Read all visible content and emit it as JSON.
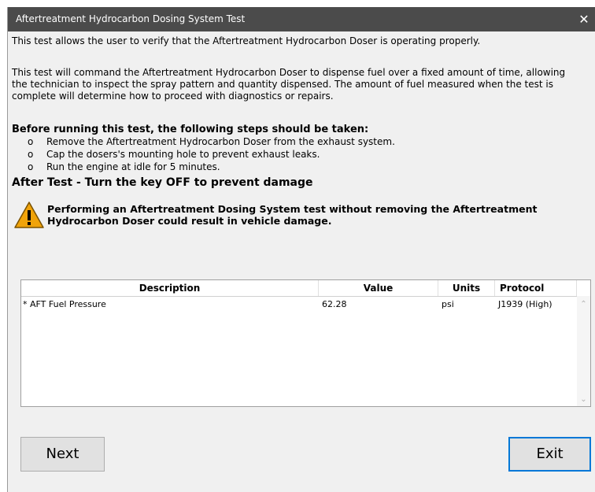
{
  "window": {
    "title": "Aftertreatment Hydrocarbon Dosing System Test",
    "close_glyph": "✕"
  },
  "intro": {
    "line1": "This test allows the user to verify that the Aftertreatment Hydrocarbon Doser is operating properly.",
    "line2": "This test will command the Aftertreatment Hydrocarbon Doser to dispense fuel over a fixed amount of time, allowing the technician to inspect the spray pattern and quantity dispensed. The amount of fuel measured when the test is complete will determine how to proceed with diagnostics or repairs."
  },
  "steps": {
    "heading": "Before running this test, the following steps should be taken:",
    "bullet": "o",
    "items": [
      "Remove the Aftertreatment Hydrocarbon Doser from the exhaust system.",
      "Cap the dosers's mounting hole to prevent exhaust leaks.",
      "Run the engine at idle for 5 minutes."
    ]
  },
  "after_test": "After Test - Turn the key OFF to prevent damage",
  "warning": {
    "icon": "warning-icon",
    "text": "Performing an Aftertreatment Dosing System test without removing the Aftertreatment Hydrocarbon Doser could result in vehicle damage."
  },
  "table": {
    "headers": {
      "description": "Description",
      "value": "Value",
      "units": "Units",
      "protocol": "Protocol"
    },
    "rows": [
      {
        "description": "* AFT Fuel Pressure",
        "value": "62.28",
        "units": "psi",
        "protocol": "J1939 (High)"
      }
    ]
  },
  "buttons": {
    "next": "Next",
    "exit": "Exit"
  },
  "colors": {
    "titlebar": "#4b4b4b",
    "focus_border": "#0078d7",
    "warning_fill": "#f0a30a"
  }
}
